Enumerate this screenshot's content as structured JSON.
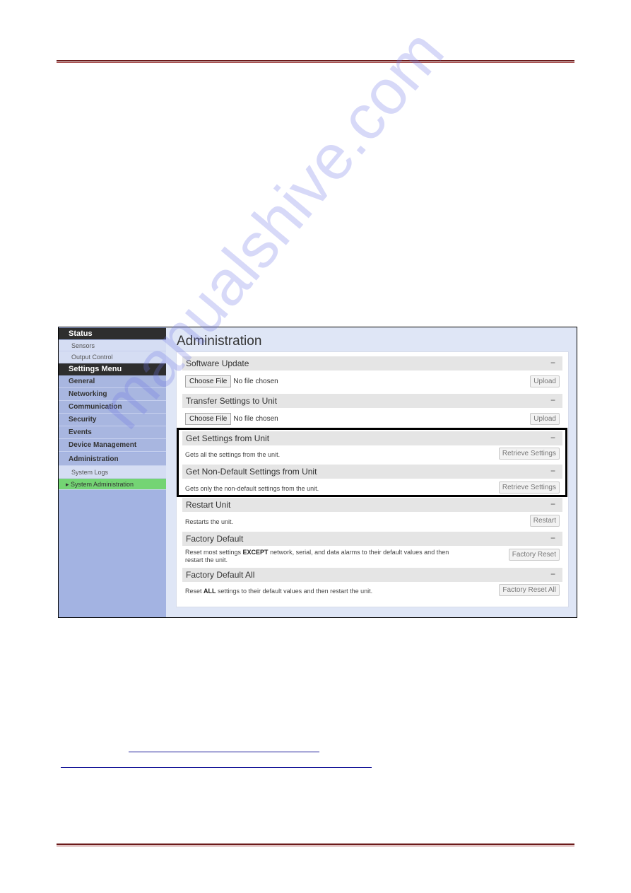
{
  "sidebar": {
    "items": [
      {
        "label": "Status",
        "kind": "dark"
      },
      {
        "label": "Sensors",
        "kind": "sub"
      },
      {
        "label": "Output Control",
        "kind": "sub"
      },
      {
        "label": "Settings Menu",
        "kind": "dark"
      },
      {
        "label": "General",
        "kind": "main"
      },
      {
        "label": "Networking",
        "kind": "main"
      },
      {
        "label": "Communication",
        "kind": "main"
      },
      {
        "label": "Security",
        "kind": "main"
      },
      {
        "label": "Events",
        "kind": "main"
      },
      {
        "label": "Device Management",
        "kind": "main"
      },
      {
        "label": "Administration",
        "kind": "main"
      },
      {
        "label": "System Logs",
        "kind": "sub"
      },
      {
        "label": "System Administration",
        "kind": "active"
      }
    ]
  },
  "main": {
    "title": "Administration",
    "sections": [
      {
        "title": "Software Update",
        "choose": "Choose File",
        "nofile": "No file chosen",
        "button": "Upload"
      },
      {
        "title": "Transfer Settings to Unit",
        "choose": "Choose File",
        "nofile": "No file chosen",
        "button": "Upload"
      },
      {
        "title": "Get Settings from Unit",
        "desc": "Gets all the settings from the unit.",
        "button": "Retrieve Settings"
      },
      {
        "title": "Get Non-Default Settings from Unit",
        "desc": "Gets only the non-default settings from the unit.",
        "button": "Retrieve Settings"
      },
      {
        "title": "Restart Unit",
        "desc": "Restarts the unit.",
        "button": "Restart"
      },
      {
        "title": "Factory Default",
        "desc_pre": "Reset most settings ",
        "desc_bold": "EXCEPT",
        "desc_post": " network, serial, and data alarms to their default values and then restart the unit.",
        "button": "Factory Reset"
      },
      {
        "title": "Factory Default All",
        "desc_pre": "Reset ",
        "desc_bold": "ALL",
        "desc_post": " settings to their default values and then restart the unit.",
        "button": "Factory Reset All"
      }
    ],
    "collapse": "−"
  },
  "watermark": "manualshive.com"
}
